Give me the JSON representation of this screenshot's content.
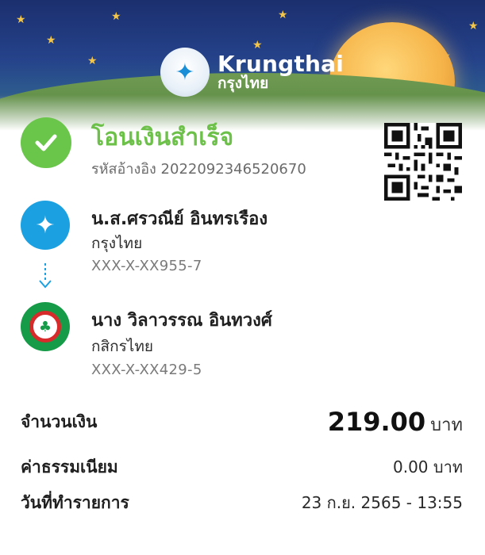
{
  "brand": {
    "name_en": "Krungthai",
    "name_th": "กรุงไทย"
  },
  "status": {
    "title": "โอนเงินสำเร็จ",
    "reference": "รหัสอ้างอิง 2022092346520670"
  },
  "sender": {
    "name": "น.ส.ศรวณีย์ อินทรเรือง",
    "bank": "กรุงไทย",
    "account": "XXX-X-XX955-7"
  },
  "receiver": {
    "name": "นาง วิลาวรรณ อินทวงศ์",
    "bank": "กสิกรไทย",
    "account": "XXX-X-XX429-5"
  },
  "details": {
    "amount_label": "จำนวนเงิน",
    "amount_value": "219.00",
    "amount_unit": "บาท",
    "fee_label": "ค่าธรรมเนียม",
    "fee_value": "0.00 บาท",
    "date_label": "วันที่ทำรายการ",
    "date_value": "23 ก.ย. 2565 - 13:55"
  },
  "colors": {
    "success_green": "#6ac64a",
    "krungthai_blue": "#1ba1e2",
    "kbank_green": "#169b48"
  },
  "icons": {
    "success": "check-circle-icon",
    "sender_bank": "krungthai-logo-icon",
    "receiver_bank": "kasikorn-logo-icon",
    "transfer": "arrow-down-icon",
    "qr": "qr-code-icon"
  }
}
